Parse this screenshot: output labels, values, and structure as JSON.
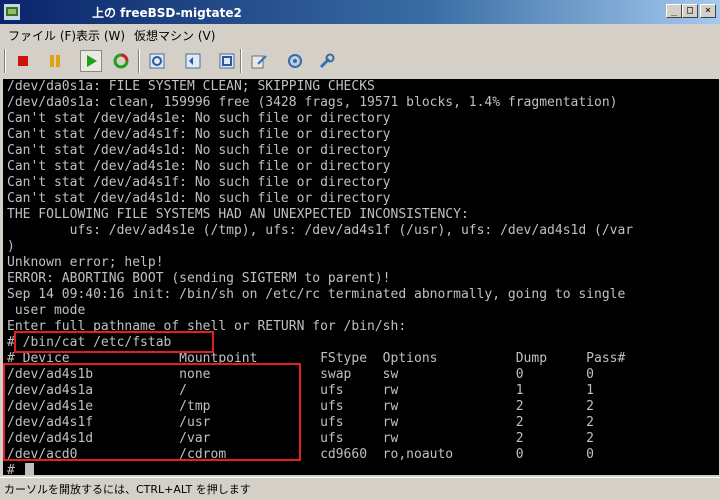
{
  "window": {
    "title": "上の freeBSD-migtate2",
    "minimize": "_",
    "maximize": "□",
    "close": "×"
  },
  "menu": [
    "ファイル (F)",
    "表示 (W)",
    "仮想マシン (V)"
  ],
  "toolbar_icons": [
    "stop-icon",
    "pause-icon",
    "play-icon",
    "reset-icon",
    "snapshot-icon",
    "revert-snapshot-icon",
    "manage-snapshots-icon",
    "edit-settings-icon",
    "connect-device-icon",
    "install-tools-icon"
  ],
  "console": {
    "lines": [
      "/dev/da0s1a: FILE SYSTEM CLEAN; SKIPPING CHECKS",
      "/dev/da0s1a: clean, 159996 free (3428 frags, 19571 blocks, 1.4% fragmentation)",
      "Can't stat /dev/ad4s1e: No such file or directory",
      "Can't stat /dev/ad4s1f: No such file or directory",
      "Can't stat /dev/ad4s1d: No such file or directory",
      "Can't stat /dev/ad4s1e: No such file or directory",
      "Can't stat /dev/ad4s1f: No such file or directory",
      "Can't stat /dev/ad4s1d: No such file or directory",
      "THE FOLLOWING FILE SYSTEMS HAD AN UNEXPECTED INCONSISTENCY:",
      "        ufs: /dev/ad4s1e (/tmp), ufs: /dev/ad4s1f (/usr), ufs: /dev/ad4s1d (/var",
      ")",
      "Unknown error; help!",
      "ERROR: ABORTING BOOT (sending SIGTERM to parent)!",
      "Sep 14 09:40:16 init: /bin/sh on /etc/rc terminated abnormally, going to single",
      " user mode",
      "Enter full pathname of shell or RETURN for /bin/sh:",
      "# /bin/cat /etc/fstab",
      "# Device              Mountpoint        FStype  Options          Dump     Pass#",
      "/dev/ad4s1b           none              swap    sw               0        0",
      "/dev/ad4s1a           /                 ufs     rw               1        1",
      "/dev/ad4s1e           /tmp              ufs     rw               2        2",
      "/dev/ad4s1f           /usr              ufs     rw               2        2",
      "/dev/ad4s1d           /var              ufs     rw               2        2",
      "/dev/acd0             /cdrom            cd9660  ro,noauto        0        0",
      "#"
    ]
  },
  "status_bar": "カーソルを開放するには、CTRL+ALT を押します"
}
